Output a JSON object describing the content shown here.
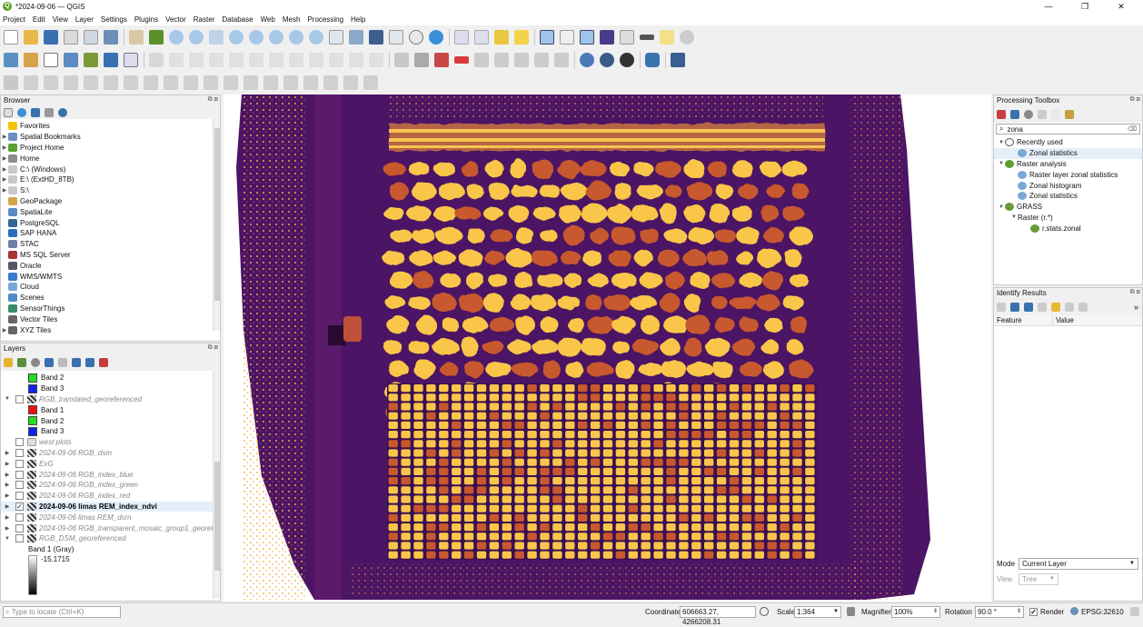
{
  "window": {
    "title": "*2024-09-06 — QGIS",
    "minimize": "—",
    "maximize": "❐",
    "close": "✕"
  },
  "menu": [
    "Project",
    "Edit",
    "View",
    "Layer",
    "Settings",
    "Plugins",
    "Vector",
    "Raster",
    "Database",
    "Web",
    "Mesh",
    "Processing",
    "Help"
  ],
  "browser": {
    "title": "Browser",
    "items": [
      {
        "label": "Favorites",
        "icon": "star-icon",
        "color": "#f2c200",
        "expand": false
      },
      {
        "label": "Spatial Bookmarks",
        "icon": "bookmark-icon",
        "color": "#6a8fc4",
        "expand": true
      },
      {
        "label": "Project Home",
        "icon": "project-home-icon",
        "color": "#5aa02c",
        "expand": true
      },
      {
        "label": "Home",
        "icon": "home-icon",
        "color": "#8c8c8c",
        "expand": true
      },
      {
        "label": "C:\\ (Windows)",
        "icon": "drive-icon",
        "color": "#c9c9c9",
        "expand": true
      },
      {
        "label": "E:\\ (ExtHD_8TB)",
        "icon": "drive-icon",
        "color": "#c9c9c9",
        "expand": true
      },
      {
        "label": "S:\\",
        "icon": "drive-icon",
        "color": "#c9c9c9",
        "expand": true
      },
      {
        "label": "GeoPackage",
        "icon": "geopackage-icon",
        "color": "#d4a44c",
        "expand": false
      },
      {
        "label": "SpatiaLite",
        "icon": "spatialite-icon",
        "color": "#5c8ac4",
        "expand": false
      },
      {
        "label": "PostgreSQL",
        "icon": "postgresql-icon",
        "color": "#336791",
        "expand": false
      },
      {
        "label": "SAP HANA",
        "icon": "sap-hana-icon",
        "color": "#2a6ebb",
        "expand": false
      },
      {
        "label": "STAC",
        "icon": "stac-icon",
        "color": "#6c7fa8",
        "expand": false
      },
      {
        "label": "MS SQL Server",
        "icon": "mssql-icon",
        "color": "#a33",
        "expand": false
      },
      {
        "label": "Oracle",
        "icon": "oracle-icon",
        "color": "#556",
        "expand": false
      },
      {
        "label": "WMS/WMTS",
        "icon": "wms-icon",
        "color": "#3a7bc8",
        "expand": false
      },
      {
        "label": "Cloud",
        "icon": "cloud-icon",
        "color": "#7aa6d8",
        "expand": false
      },
      {
        "label": "Scenes",
        "icon": "scenes-icon",
        "color": "#4f8bc9",
        "expand": false
      },
      {
        "label": "SensorThings",
        "icon": "sensorthings-icon",
        "color": "#3a8b6a",
        "expand": false
      },
      {
        "label": "Vector Tiles",
        "icon": "vector-tiles-icon",
        "color": "#666",
        "expand": false
      },
      {
        "label": "XYZ Tiles",
        "icon": "xyz-tiles-icon",
        "color": "#666",
        "expand": true
      }
    ]
  },
  "layers": {
    "title": "Layers",
    "items": [
      {
        "kind": "band",
        "label": "Band 2",
        "swatch": "#22dd22"
      },
      {
        "kind": "band",
        "label": "Band 3",
        "swatch": "#1122ee"
      },
      {
        "kind": "layer",
        "label": "RGB_translated_georeferenced",
        "checked": false,
        "expanded": true
      },
      {
        "kind": "band",
        "label": "Band 1",
        "swatch": "#ee1111"
      },
      {
        "kind": "band",
        "label": "Band 2",
        "swatch": "#22dd22"
      },
      {
        "kind": "band",
        "label": "Band 3",
        "swatch": "#1122ee"
      },
      {
        "kind": "vector",
        "label": "west plots",
        "checked": false
      },
      {
        "kind": "layer",
        "label": "2024-09-06 RGB_dsm",
        "checked": false
      },
      {
        "kind": "layer",
        "label": "ExG",
        "checked": false
      },
      {
        "kind": "layer",
        "label": "2024-09-06 RGB_index_blue",
        "checked": false
      },
      {
        "kind": "layer",
        "label": "2024-09-06 RGB_index_green",
        "checked": false
      },
      {
        "kind": "layer",
        "label": "2024-09-06 RGB_index_red",
        "checked": false
      },
      {
        "kind": "layer",
        "label": "2024-09-06 limas REM_index_ndvi",
        "checked": true,
        "selected": true
      },
      {
        "kind": "layer",
        "label": "2024-09-06 limas REM_dsm",
        "checked": false
      },
      {
        "kind": "layer",
        "label": "2024-09-06 RGB_transparent_mosaic_group1_georef",
        "checked": false
      },
      {
        "kind": "layer",
        "label": "RGB_DSM_georeferenced",
        "checked": false,
        "expanded": true
      },
      {
        "kind": "text",
        "label": "Band 1 (Gray)"
      }
    ],
    "ramp_min": "-15.1715"
  },
  "toolbox": {
    "title": "Processing Toolbox",
    "search_value": "zona",
    "tree": [
      {
        "level": 0,
        "label": "Recently used",
        "icon": "clock-icon"
      },
      {
        "level": 1,
        "label": "Zonal statistics",
        "icon": "gear-icon",
        "selected": true
      },
      {
        "level": 0,
        "label": "Raster analysis",
        "icon": "qgis-icon"
      },
      {
        "level": 1,
        "label": "Raster layer zonal statistics",
        "icon": "gear-icon"
      },
      {
        "level": 1,
        "label": "Zonal histogram",
        "icon": "gear-icon"
      },
      {
        "level": 1,
        "label": "Zonal statistics",
        "icon": "gear-icon"
      },
      {
        "level": 0,
        "label": "GRASS",
        "icon": "grass-icon"
      },
      {
        "level": 1,
        "label": "Raster (r.*)",
        "icon": ""
      },
      {
        "level": 2,
        "label": "r.stats.zonal",
        "icon": "grass-icon"
      }
    ]
  },
  "identify": {
    "title": "Identify Results",
    "col_feature": "Feature",
    "col_value": "Value",
    "mode_label": "Mode",
    "mode_value": "Current Layer",
    "view_label": "View",
    "view_value": "Tree"
  },
  "status": {
    "locator_placeholder": "Type to locate (Ctrl+K)",
    "coordinate_label": "Coordinate",
    "coordinate_value": "606663.27, 4266208.31",
    "scale_label": "Scale",
    "scale_value": "1:364",
    "magnifier_label": "Magnifier",
    "magnifier_value": "100%",
    "rotation_label": "Rotation",
    "rotation_value": "90.0 °",
    "render_label": "Render",
    "crs": "EPSG:32610"
  },
  "colors": {
    "ndvi_low": "#5a1a78",
    "ndvi_mid": "#c8582d",
    "ndvi_high": "#f9c64a"
  }
}
